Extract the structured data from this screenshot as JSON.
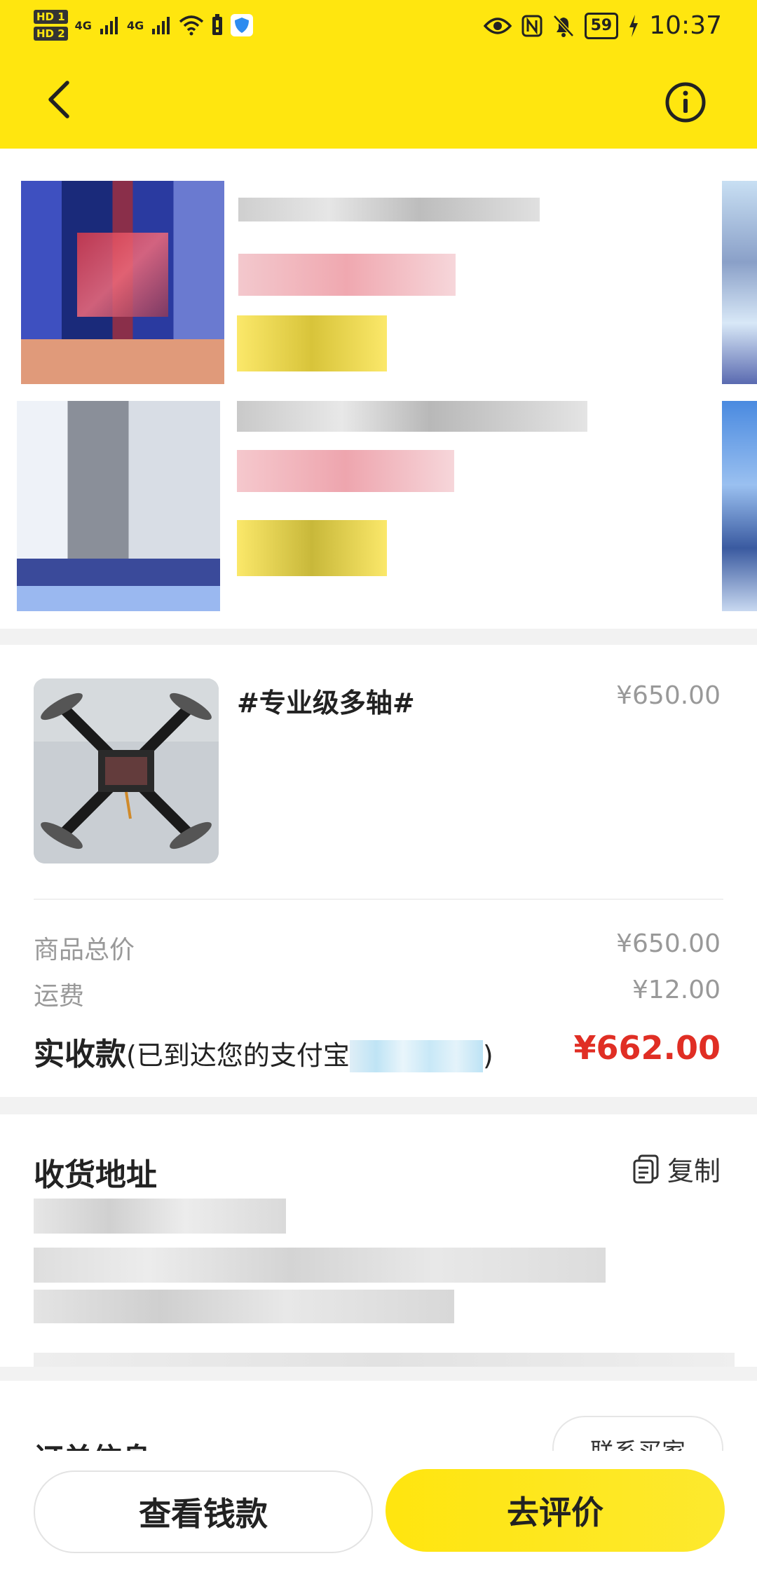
{
  "status_bar": {
    "sim1": "HD 1",
    "sim2": "HD 2",
    "network1": "4G",
    "network2": "4G",
    "battery": "59",
    "time": "10:37"
  },
  "header": {
    "back_icon": "back-arrow-icon",
    "info_icon": "info-icon"
  },
  "product": {
    "name": "#专业级多轴#",
    "price": "¥650.00"
  },
  "summary": {
    "subtotal_label": "商品总价",
    "subtotal_value": "¥650.00",
    "shipping_label": "运费",
    "shipping_value": "¥12.00",
    "received_label": "实收款",
    "received_note_open": "(已到达您的支付宝",
    "received_note_close": ")",
    "received_value": "¥662.00"
  },
  "address": {
    "title": "收货地址",
    "copy_label": "复制"
  },
  "order": {
    "title": "订单信息",
    "contact_button": "联系买家"
  },
  "bottom_bar": {
    "view_money_button": "查看钱款",
    "review_button": "去评价"
  },
  "colors": {
    "brand_yellow": "#ffe60f",
    "price_red": "#e02e24",
    "muted_gray": "#999999"
  }
}
